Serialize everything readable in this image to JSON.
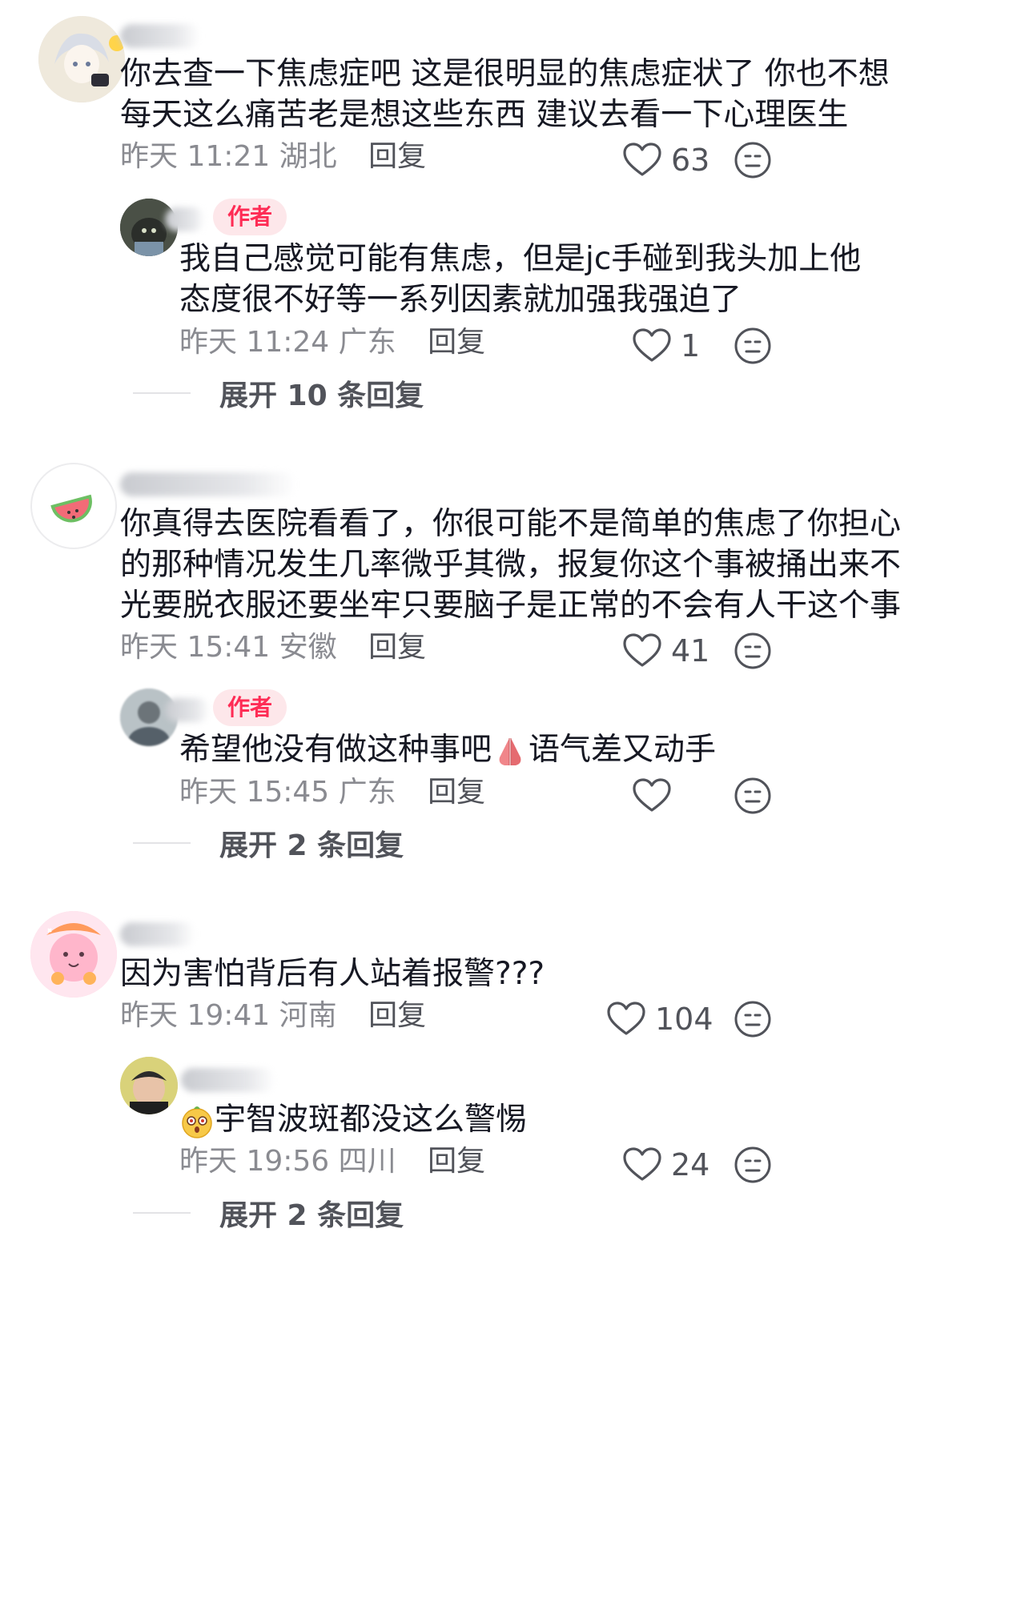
{
  "comments": [
    {
      "text_lines": [
        "你去查一下焦虑症吧 这是很明显的焦虑症状了 你也不想",
        "每天这么痛苦老是想这些东西 建议去看一下心理医生"
      ],
      "time": "昨天 11:21",
      "location": "湖北",
      "reply_label": "回复",
      "likes": "63",
      "reply": {
        "author_tag": "作者",
        "text_lines": [
          "我自己感觉可能有焦虑，但是jc手碰到我头加上他",
          "态度很不好等一系列因素就加强我强迫了"
        ],
        "time": "昨天 11:24",
        "location": "广东",
        "reply_label": "回复",
        "likes": "1"
      },
      "expand_label": "展开 10 条回复"
    },
    {
      "text_lines": [
        "你真得去医院看看了，你很可能不是简单的焦虑了你担心",
        "的那种情况发生几率微乎其微，报复你这个事被捅出来不",
        "光要脱衣服还要坐牢只要脑子是正常的不会有人干这个事"
      ],
      "time": "昨天 15:41",
      "location": "安徽",
      "reply_label": "回复",
      "likes": "41",
      "reply": {
        "author_tag": "作者",
        "text_before_emoji": "希望他没有做这种事吧",
        "emoji": "praying-hands",
        "text_after_emoji": "语气差又动手",
        "time": "昨天 15:45",
        "location": "广东",
        "reply_label": "回复",
        "likes": ""
      },
      "expand_label": "展开 2 条回复"
    },
    {
      "text_lines": [
        "因为害怕背后有人站着报警???"
      ],
      "time": "昨天 19:41",
      "location": "河南",
      "reply_label": "回复",
      "likes": "104",
      "reply": {
        "emoji": "surprised-face",
        "text": "宇智波斑都没这么警惕",
        "time": "昨天 19:56",
        "location": "四川",
        "reply_label": "回复",
        "likes": "24"
      },
      "expand_label": "展开 2 条回复"
    }
  ],
  "colors": {
    "text": "#161823",
    "meta": "#8a8b91",
    "author_tag_bg": "#fde7ea",
    "author_tag_text": "#fe2c55",
    "icon": "#51535a"
  }
}
